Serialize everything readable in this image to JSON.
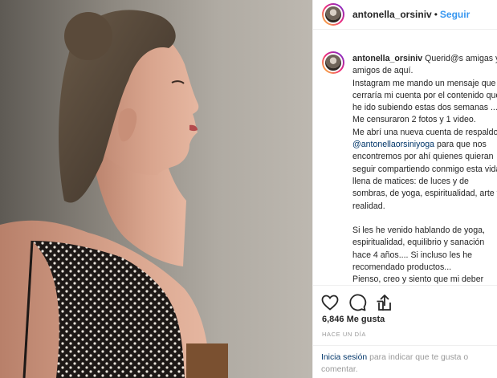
{
  "post": {
    "username": "antonella_orsiniv",
    "separator": "•",
    "follow_label": "Seguir"
  },
  "caption": {
    "username": "antonella_orsiniv",
    "p1": "Querid@s amigas y amigos de aquí.",
    "p2": "Instagram me mando un mensaje que cerraría mi cuenta por el contenido que he ido subiendo estas dos semanas ... Me censuraron 2 fotos y 1 video.",
    "p3a": "Me abrí una nueva cuenta de respaldo ",
    "mention": "@antonellaorsiniyoga",
    "p3b": " para que nos encontremos por ahí quienes quieran seguir compartiendo conmigo esta vida llena de matices: de luces y de sombras, de yoga, espiritualidad, arte y realidad.",
    "p4": "Si les he venido hablando de yoga, espiritualidad, equilibrio y sanación hace 4 años.... Si incluso les he recomendado productos...",
    "p5": "Pienso, creo y siento que mi deber"
  },
  "footer": {
    "likes": "6,846 Me gusta",
    "time_ago": "HACE UN DÍA",
    "login_link": "Inicia sesión",
    "login_text": " para indicar que te gusta o comentar."
  },
  "icons": {
    "like": "heart-icon",
    "comment": "comment-icon",
    "share": "share-icon"
  }
}
